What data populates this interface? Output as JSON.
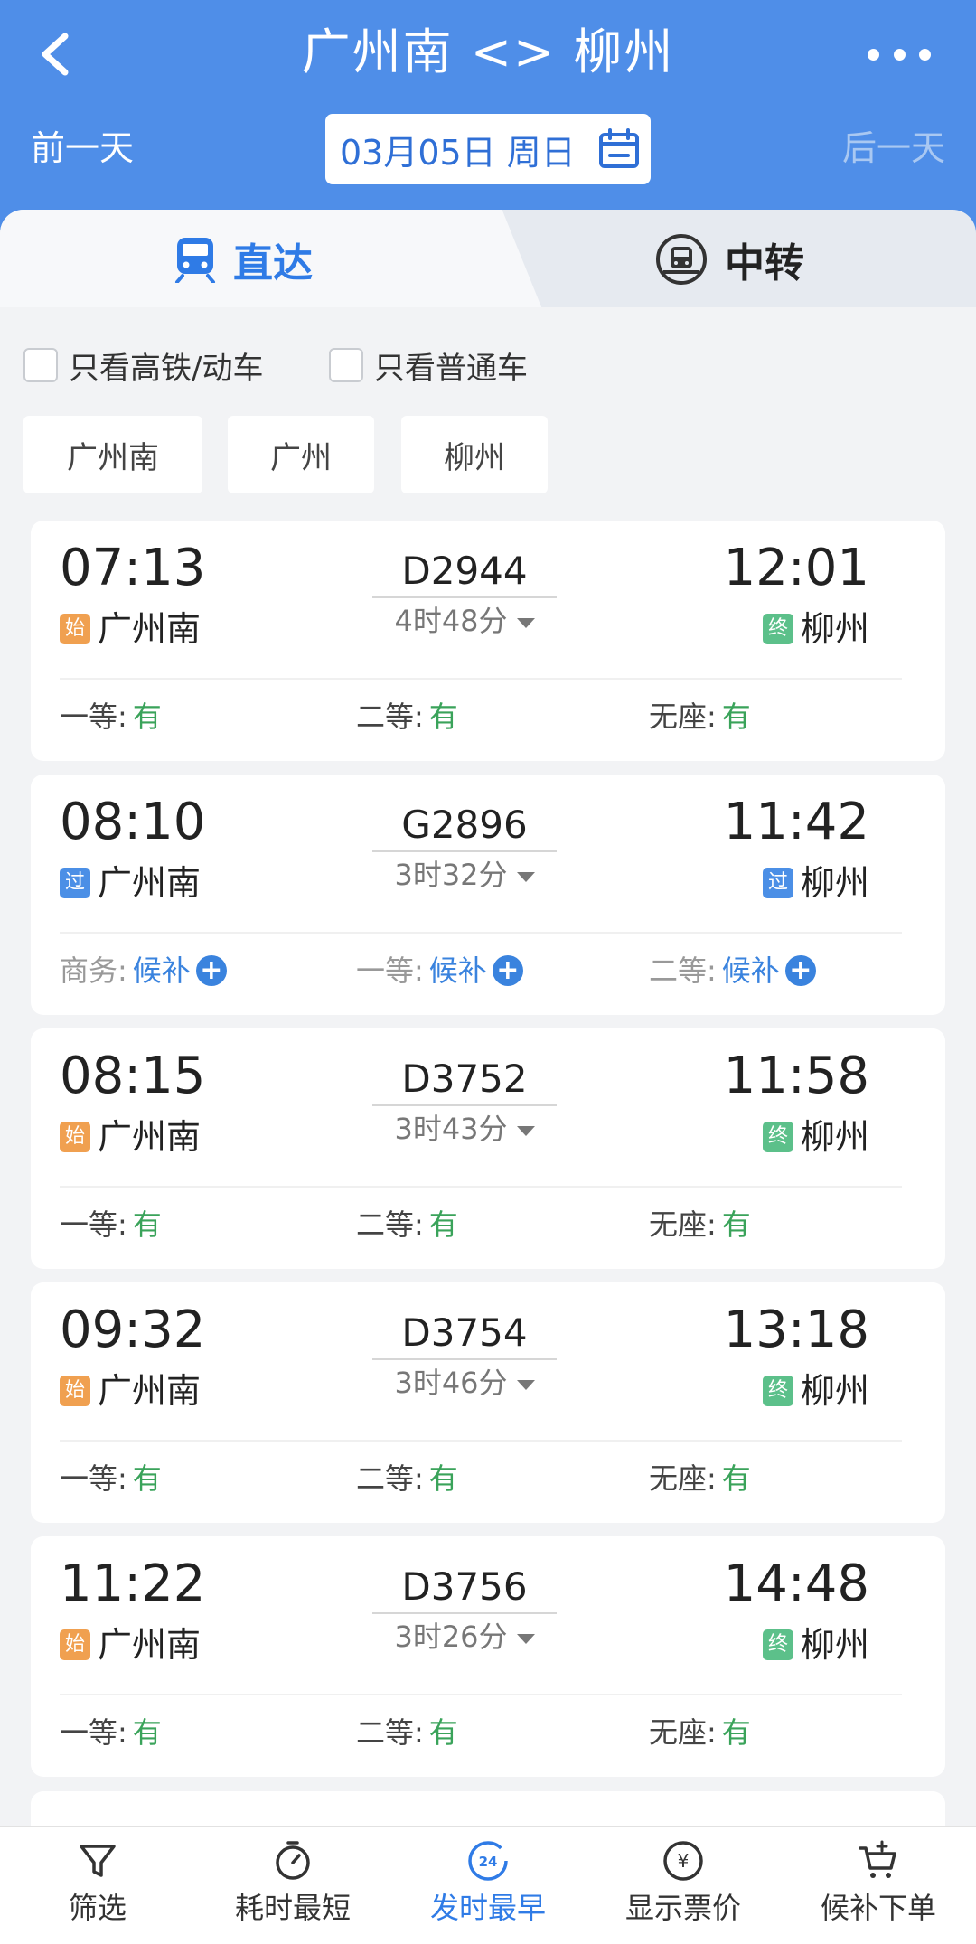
{
  "header": {
    "title": "广州南 <> 柳州",
    "prev_day": "前一天",
    "date": "03月05日 周日",
    "next_day": "后一天"
  },
  "tabs": [
    {
      "label": "直达",
      "icon": "train-icon",
      "active": true
    },
    {
      "label": "中转",
      "icon": "transfer-icon",
      "active": false
    }
  ],
  "filters": {
    "high_speed_only": "只看高铁/动车",
    "regular_only": "只看普通车"
  },
  "station_chips": [
    "广州南",
    "广州",
    "柳州"
  ],
  "trains": [
    {
      "dep_time": "07:13",
      "train_no": "D2944",
      "duration": "4时48分",
      "arr_time": "12:01",
      "dep_badge": "始",
      "dep_station": "广州南",
      "arr_badge": "终",
      "arr_station": "柳州",
      "seats": [
        {
          "label": "一等:",
          "value": "有"
        },
        {
          "label": "二等:",
          "value": "有"
        },
        {
          "label": "无座:",
          "value": "有"
        }
      ]
    },
    {
      "dep_time": "08:10",
      "train_no": "G2896",
      "duration": "3时32分",
      "arr_time": "11:42",
      "dep_badge": "过",
      "dep_station": "广州南",
      "arr_badge": "过",
      "arr_station": "柳州",
      "seats": [
        {
          "label": "商务:",
          "value": "候补"
        },
        {
          "label": "一等:",
          "value": "候补"
        },
        {
          "label": "二等:",
          "value": "候补"
        }
      ]
    },
    {
      "dep_time": "08:15",
      "train_no": "D3752",
      "duration": "3时43分",
      "arr_time": "11:58",
      "dep_badge": "始",
      "dep_station": "广州南",
      "arr_badge": "终",
      "arr_station": "柳州",
      "seats": [
        {
          "label": "一等:",
          "value": "有"
        },
        {
          "label": "二等:",
          "value": "有"
        },
        {
          "label": "无座:",
          "value": "有"
        }
      ]
    },
    {
      "dep_time": "09:32",
      "train_no": "D3754",
      "duration": "3时46分",
      "arr_time": "13:18",
      "dep_badge": "始",
      "dep_station": "广州南",
      "arr_badge": "终",
      "arr_station": "柳州",
      "seats": [
        {
          "label": "一等:",
          "value": "有"
        },
        {
          "label": "二等:",
          "value": "有"
        },
        {
          "label": "无座:",
          "value": "有"
        }
      ]
    },
    {
      "dep_time": "11:22",
      "train_no": "D3756",
      "duration": "3时26分",
      "arr_time": "14:48",
      "dep_badge": "始",
      "dep_station": "广州南",
      "arr_badge": "终",
      "arr_station": "柳州",
      "seats": [
        {
          "label": "一等:",
          "value": "有"
        },
        {
          "label": "二等:",
          "value": "有"
        },
        {
          "label": "无座:",
          "value": "有"
        }
      ]
    }
  ],
  "bottom_nav": [
    {
      "label": "筛选",
      "icon": "filter-icon"
    },
    {
      "label": "耗时最短",
      "icon": "timer-icon"
    },
    {
      "label": "发时最早",
      "icon": "clock-24-icon",
      "active": true,
      "icon_text": "24"
    },
    {
      "label": "显示票价",
      "icon": "yuan-icon",
      "icon_text": "¥"
    },
    {
      "label": "候补下单",
      "icon": "cart-icon"
    }
  ],
  "colors": {
    "header_blue": "#4f8ee8",
    "accent_blue": "#2f7be6",
    "available_green": "#3aa35a",
    "badge_start_orange": "#f0a050",
    "badge_end_green": "#5cc08a",
    "badge_pass_blue": "#4b8fe6"
  }
}
